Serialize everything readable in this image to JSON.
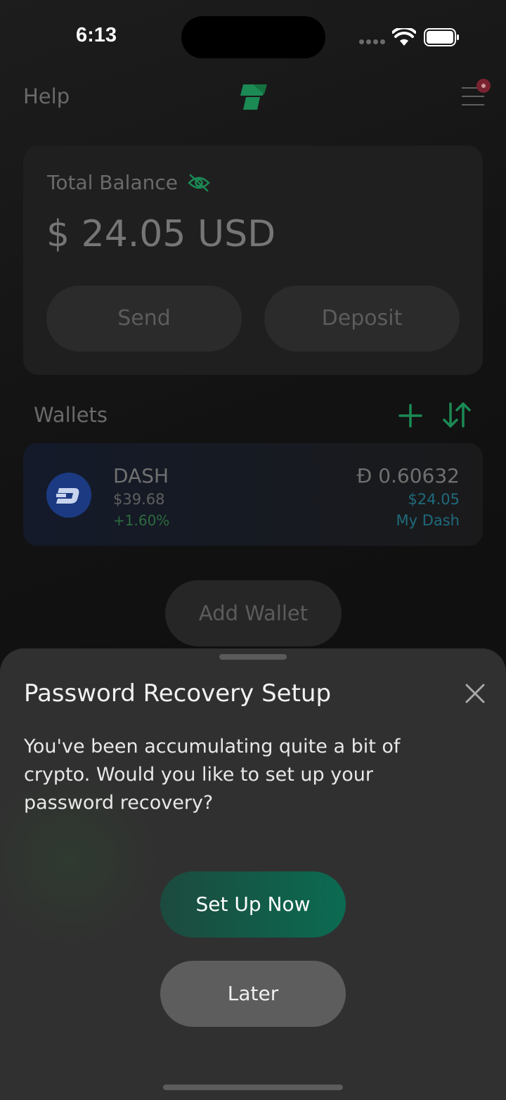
{
  "status_bar": {
    "time": "6:13"
  },
  "header": {
    "help_label": "Help",
    "logo_icon": "app-logo-icon",
    "menu_icon": "hamburger-menu-icon"
  },
  "balance": {
    "label": "Total Balance",
    "amount": "$ 24.05 USD",
    "visibility_icon": "eye-off-icon",
    "send_label": "Send",
    "deposit_label": "Deposit"
  },
  "wallets": {
    "title": "Wallets",
    "items": [
      {
        "coin": "DASH",
        "price": "$39.68",
        "change": "+1.60%",
        "crypto_balance": "Đ 0.60632",
        "fiat_balance": "$24.05",
        "wallet_name": "My Dash"
      }
    ],
    "add_wallet_label": "Add Wallet"
  },
  "sheet": {
    "title": "Password Recovery Setup",
    "message": "You've been accumulating quite a bit of crypto. Would you like to set up your password recovery?",
    "primary_label": "Set Up Now",
    "secondary_label": "Later"
  },
  "colors": {
    "accent_green": "#0b6b52",
    "icon_green": "#1b8a55",
    "dash_blue": "#1c3a82",
    "wallet_teal": "#1f6a7c"
  }
}
